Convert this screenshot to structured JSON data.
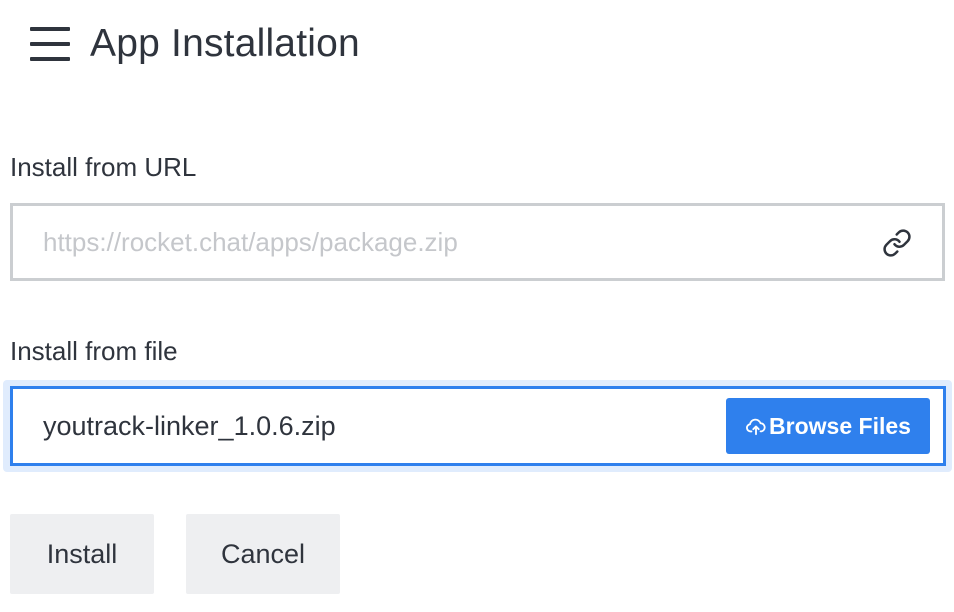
{
  "header": {
    "menu_icon": "hamburger-menu-icon",
    "title": "App Installation"
  },
  "url_section": {
    "label": "Install from URL",
    "placeholder": "https://rocket.chat/apps/package.zip",
    "value": "",
    "icon": "link-icon"
  },
  "file_section": {
    "label": "Install from file",
    "file_name": "youtrack-linker_1.0.6.zip",
    "browse_label": "Browse Files",
    "browse_icon": "cloud-upload-icon"
  },
  "actions": {
    "install_label": "Install",
    "cancel_label": "Cancel"
  },
  "colors": {
    "primary": "#2f80ed",
    "text": "#2f343d",
    "border": "#cbced1",
    "button_bg": "#eeeff1",
    "placeholder": "#c5c7cb"
  }
}
